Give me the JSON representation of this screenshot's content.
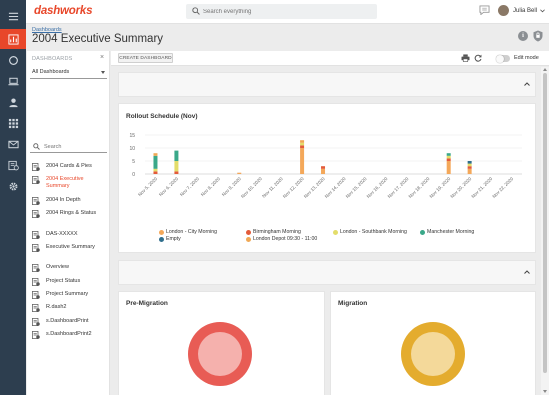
{
  "app": {
    "logo_text": "dashworks"
  },
  "header": {
    "search_placeholder": "Search everything",
    "user_name": "Julia Bell",
    "info_icon_glyph": "i"
  },
  "breadcrumb": "Dashboards",
  "page_title": "2004 Executive Summary",
  "rail_icons": [
    "menu-icon",
    "dashboard-icon",
    "discovery-icon",
    "device-icon",
    "user-icon",
    "application-icon",
    "mailbox-icon",
    "evergreen-icon",
    "settings-icon"
  ],
  "dashboards_panel": {
    "heading": "DASHBOARDS",
    "close_glyph": "×",
    "filter_value": "All Dashboards",
    "search_placeholder": "Search",
    "items": [
      {
        "label": "2004 Cards & Pies",
        "selected": false
      },
      {
        "label": "2004 Executive Summary",
        "selected": true
      },
      {
        "label": "2004 In Depth",
        "selected": false
      },
      {
        "label": "2004 Rings & Status",
        "selected": false
      },
      {
        "label": "DAS-XXXXX",
        "selected": false
      },
      {
        "label": "Executive Summary",
        "selected": false
      },
      {
        "label": "Overview",
        "selected": false
      },
      {
        "label": "Project Status",
        "selected": false
      },
      {
        "label": "Project Summary",
        "selected": false
      },
      {
        "label": "R.dash2",
        "selected": false
      },
      {
        "label": "s.DashboardPrint",
        "selected": false
      },
      {
        "label": "s.DashboardPrint2",
        "selected": false
      }
    ]
  },
  "toolbar": {
    "create_button": "CREATE DASHBOARD",
    "edit_mode_label": "Edit mode",
    "edit_mode_on": false
  },
  "rollout_card": {
    "title": "Rollout Schedule (Nov)"
  },
  "colors": {
    "accent": "#e8472a",
    "rail": "#2d3e4f",
    "premigration_ring": "#e85c55",
    "premigration_fill": "#f5b1ad",
    "migration_ring": "#e4ac2e",
    "migration_fill": "#f4d99a"
  },
  "chart_data": {
    "type": "bar",
    "stacked": true,
    "title": "Rollout Schedule (Nov)",
    "xlabel": "",
    "ylabel": "",
    "ylim": [
      0,
      15
    ],
    "yticks": [
      0,
      5,
      10,
      15
    ],
    "grid": true,
    "legend_position": "bottom",
    "categories": [
      "Nov 5, 2020",
      "Nov 6, 2020",
      "Nov 7, 2020",
      "Nov 8, 2020",
      "Nov 9, 2020",
      "Nov 10, 2020",
      "Nov 11, 2020",
      "Nov 12, 2020",
      "Nov 13, 2020",
      "Nov 14, 2020",
      "Nov 15, 2020",
      "Nov 16, 2020",
      "Nov 17, 2020",
      "Nov 18, 2020",
      "Nov 19, 2020",
      "Nov 20, 2020",
      "Nov 21, 2020",
      "Nov 22, 2020"
    ],
    "series": [
      {
        "name": "London - City Morning",
        "color": "#f4a85a",
        "values": [
          0,
          0,
          0,
          0,
          0.5,
          0,
          0,
          10,
          2,
          0,
          0,
          0,
          0,
          0,
          5,
          2,
          0,
          0
        ]
      },
      {
        "name": "Birmingham Morning",
        "color": "#e35b3a",
        "values": [
          1,
          1,
          0,
          0,
          0,
          0,
          0,
          1,
          1,
          0,
          0,
          0,
          0,
          0,
          1,
          1,
          0,
          0
        ]
      },
      {
        "name": "London - Southbank Morning",
        "color": "#e3dd6a",
        "values": [
          1,
          4,
          0,
          0,
          0,
          0,
          0,
          1,
          0,
          0,
          0,
          0,
          0,
          0,
          1,
          1,
          0,
          0
        ]
      },
      {
        "name": "Manchester Morning",
        "color": "#3aa889",
        "values": [
          5,
          4,
          0,
          0,
          0,
          0,
          0,
          0,
          0,
          0,
          0,
          0,
          0,
          0,
          1,
          0,
          0,
          0
        ]
      },
      {
        "name": "Empty",
        "color": "#2f6e8c",
        "values": [
          0,
          0,
          0,
          0,
          0,
          0,
          0,
          0,
          0,
          0,
          0,
          0,
          0,
          0,
          0,
          1,
          0,
          0
        ]
      },
      {
        "name": "London Depot 09:30 - 11:00",
        "color": "#f0a855",
        "values": [
          1,
          0,
          0,
          0,
          0,
          0,
          0,
          1,
          0,
          0,
          0,
          0,
          0,
          0,
          0,
          0,
          0,
          0
        ]
      }
    ]
  },
  "donuts": [
    {
      "title": "Pre-Migration"
    },
    {
      "title": "Migration"
    }
  ]
}
